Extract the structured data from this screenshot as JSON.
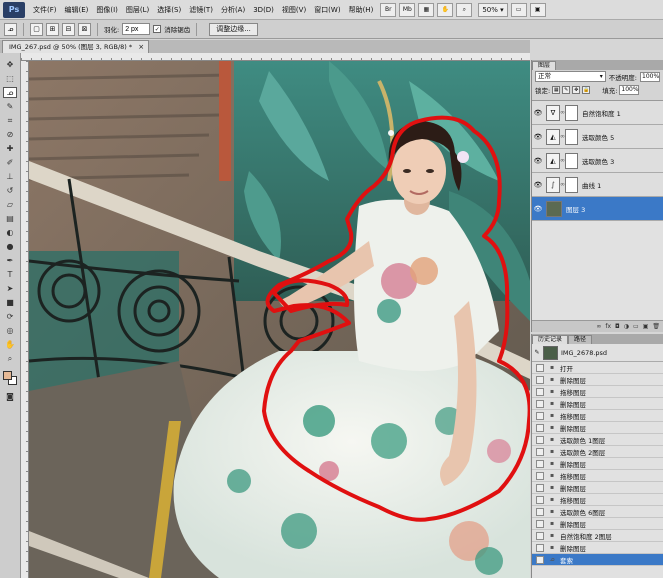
{
  "app": {
    "logo": "Ps",
    "menu": [
      "文件(F)",
      "编辑(E)",
      "图像(I)",
      "图层(L)",
      "选择(S)",
      "滤镜(T)",
      "分析(A)",
      "3D(D)",
      "视图(V)",
      "窗口(W)",
      "帮助(H)"
    ],
    "toolbar_buttons": [
      "Br",
      "Mb"
    ],
    "zoom": "50%"
  },
  "options": {
    "feather_label": "羽化:",
    "feather_value": "2 px",
    "antialias_label": "消除锯齿",
    "refine_edge": "调整边缘..."
  },
  "document": {
    "tab_title": "IMG_267.psd @ 50% (图层 3, RGB/8) *",
    "close": "×",
    "selection_color": "#e01010"
  },
  "tools": {
    "icons": [
      "move-icon",
      "marquee-icon",
      "lasso-icon",
      "quick-select-icon",
      "crop-icon",
      "eyedropper-icon",
      "healing-icon",
      "brush-icon",
      "stamp-icon",
      "history-brush-icon",
      "eraser-icon",
      "gradient-icon",
      "blur-icon",
      "dodge-icon",
      "pen-icon",
      "type-icon",
      "path-select-icon",
      "shape-icon",
      "3d-rotate-icon",
      "3d-camera-icon",
      "hand-icon",
      "zoom-icon"
    ],
    "active": "lasso-icon",
    "foreground_color": "#e5b996",
    "background_color": "#ffffff"
  },
  "layers_panel": {
    "tab": "图层",
    "blend_mode": "正常",
    "opacity_label": "不透明度:",
    "opacity": "100%",
    "lock_label": "锁定:",
    "fill_label": "填充:",
    "fill": "100%",
    "layers": [
      {
        "name": "自然饱和度 1",
        "thumb": "∇",
        "visible": true,
        "selected": false
      },
      {
        "name": "选取颜色 5",
        "thumb": "◭",
        "visible": true,
        "selected": false
      },
      {
        "name": "选取颜色 3",
        "thumb": "◭",
        "visible": true,
        "selected": false
      },
      {
        "name": "曲线 1",
        "thumb": "∫",
        "visible": true,
        "selected": false
      },
      {
        "name": "图层 3",
        "thumb": "",
        "visible": true,
        "selected": true
      }
    ],
    "footer_icons": [
      "link-icon",
      "fx-icon",
      "mask-icon",
      "adjustment-icon",
      "group-icon",
      "new-layer-icon",
      "trash-icon"
    ]
  },
  "history_panel": {
    "tabs": [
      "历史记录",
      "路径"
    ],
    "snapshot": "IMG_2678.psd",
    "items": [
      "打开",
      "删除图层",
      "拖移图层",
      "删除图层",
      "拖移图层",
      "删除图层",
      "选取颜色 1图层",
      "选取颜色 2图层",
      "删除图层",
      "拖移图层",
      "删除图层",
      "拖移图层",
      "选取颜色 6图层",
      "删除图层",
      "自然饱和度 2图层",
      "删除图层",
      "套索"
    ],
    "selected_index": 16
  }
}
